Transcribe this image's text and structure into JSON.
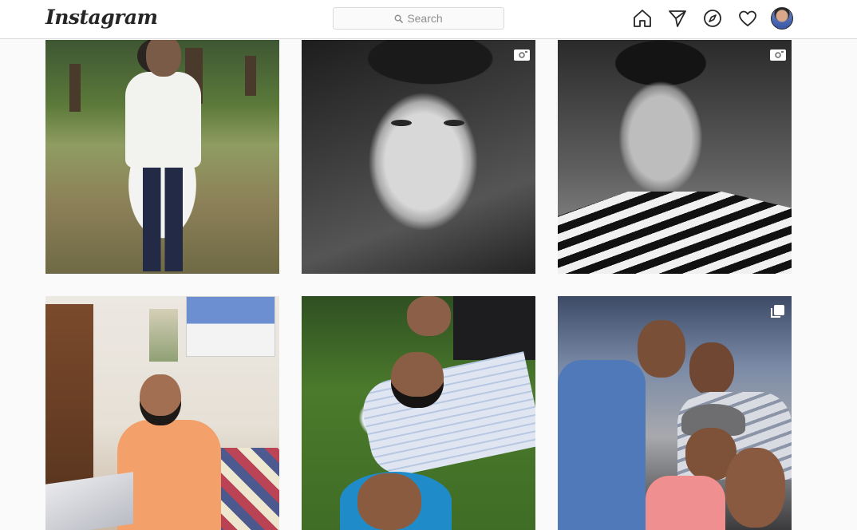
{
  "app": {
    "logo_text": "Instagram"
  },
  "search": {
    "placeholder": "Search"
  },
  "nav": {
    "icons": [
      "home-icon",
      "direct-icon",
      "explore-icon",
      "activity-heart-icon",
      "profile-avatar"
    ]
  },
  "posts": [
    {
      "kind": "photo",
      "description_icon": null
    },
    {
      "kind": "video",
      "description_icon": "video-icon"
    },
    {
      "kind": "video",
      "description_icon": "video-icon"
    },
    {
      "kind": "photo",
      "description_icon": null
    },
    {
      "kind": "photo",
      "description_icon": null
    },
    {
      "kind": "carousel",
      "description_icon": "carousel-icon"
    }
  ],
  "colors": {
    "background": "#fafafa",
    "header": "#ffffff",
    "border": "#dbdbdb",
    "icon": "#262626",
    "placeholder": "#8e8e8e"
  }
}
